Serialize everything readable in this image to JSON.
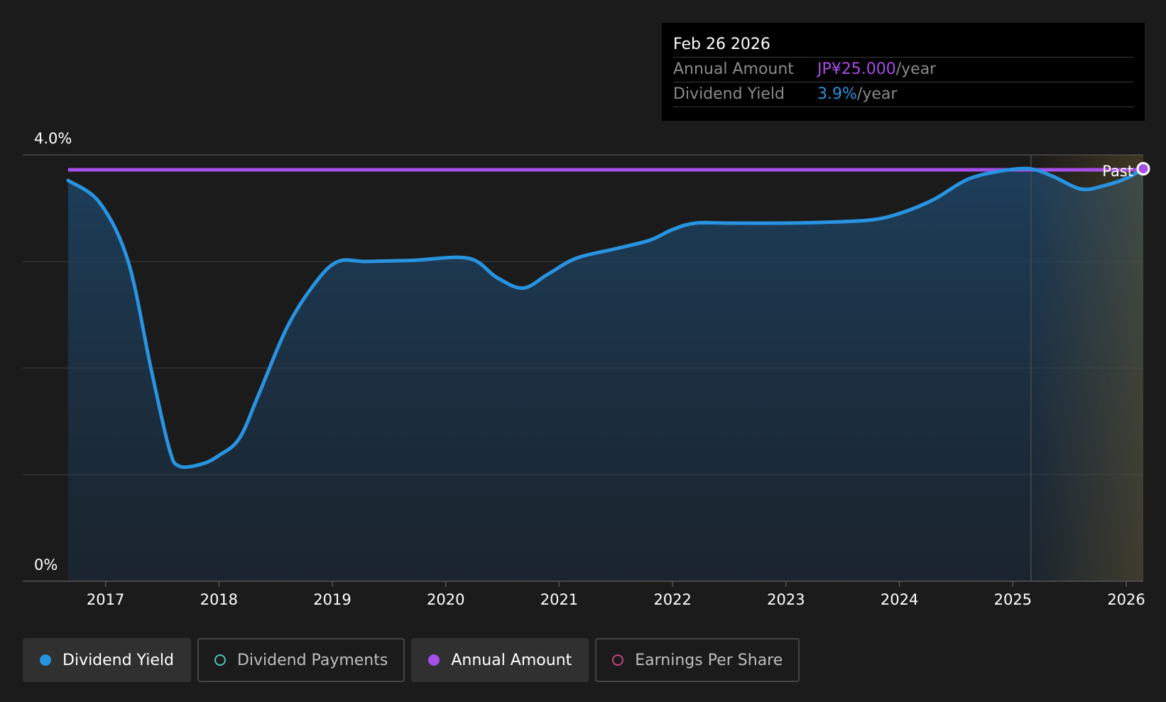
{
  "tooltip": {
    "date": "Feb 26 2026",
    "rows": [
      {
        "label": "Annual Amount",
        "value": "JP¥25.000",
        "unit": "/year",
        "color": "#a64ee8"
      },
      {
        "label": "Dividend Yield",
        "value": "3.9%",
        "unit": "/year",
        "color": "#2893e0"
      }
    ]
  },
  "past_label": "Past",
  "legend": [
    {
      "label": "Dividend Yield",
      "color": "#2893e0",
      "active": true
    },
    {
      "label": "Dividend Payments",
      "color": "#4fc4b0",
      "active": false
    },
    {
      "label": "Annual Amount",
      "color": "#a64ee8",
      "active": true
    },
    {
      "label": "Earnings Per Share",
      "color": "#c0457f",
      "active": false
    }
  ],
  "chart_data": {
    "type": "line",
    "x_range": [
      2016.27,
      2026.15
    ],
    "y_range": [
      0,
      4.0
    ],
    "y_tick_labels": [
      {
        "value": 4.0,
        "label": "4.0%"
      },
      {
        "value": 0,
        "label": "0%"
      }
    ],
    "gridlines": [
      1.0,
      2.0,
      3.0,
      4.0
    ],
    "x_ticks": [
      2017,
      2018,
      2019,
      2020,
      2021,
      2022,
      2023,
      2024,
      2025,
      2026
    ],
    "x_tick_labels": [
      "2017",
      "2018",
      "2019",
      "2020",
      "2021",
      "2022",
      "2023",
      "2024",
      "2025",
      "2026"
    ],
    "forecast_start": 2025.16,
    "series": [
      {
        "name": "Dividend Yield",
        "color": "#2893e0",
        "points": [
          [
            2016.67,
            3.76
          ],
          [
            2016.95,
            3.55
          ],
          [
            2017.2,
            3.0
          ],
          [
            2017.4,
            2.0
          ],
          [
            2017.56,
            1.25
          ],
          [
            2017.65,
            1.08
          ],
          [
            2017.85,
            1.1
          ],
          [
            2018.0,
            1.18
          ],
          [
            2018.18,
            1.34
          ],
          [
            2018.35,
            1.75
          ],
          [
            2018.6,
            2.38
          ],
          [
            2018.85,
            2.8
          ],
          [
            2019.05,
            3.0
          ],
          [
            2019.3,
            3.0
          ],
          [
            2019.7,
            3.01
          ],
          [
            2020.2,
            3.03
          ],
          [
            2020.45,
            2.85
          ],
          [
            2020.68,
            2.75
          ],
          [
            2020.9,
            2.88
          ],
          [
            2021.15,
            3.03
          ],
          [
            2021.5,
            3.12
          ],
          [
            2021.8,
            3.2
          ],
          [
            2022.0,
            3.3
          ],
          [
            2022.2,
            3.36
          ],
          [
            2022.5,
            3.36
          ],
          [
            2023.0,
            3.36
          ],
          [
            2023.4,
            3.37
          ],
          [
            2023.75,
            3.39
          ],
          [
            2024.0,
            3.45
          ],
          [
            2024.3,
            3.58
          ],
          [
            2024.6,
            3.77
          ],
          [
            2024.9,
            3.85
          ],
          [
            2025.15,
            3.87
          ],
          [
            2025.35,
            3.8
          ],
          [
            2025.6,
            3.68
          ],
          [
            2025.8,
            3.71
          ],
          [
            2026.0,
            3.78
          ],
          [
            2026.15,
            3.87
          ]
        ]
      },
      {
        "name": "Annual Amount",
        "color": "#a64ee8",
        "points": [
          [
            2016.67,
            3.86
          ],
          [
            2026.15,
            3.86
          ]
        ]
      }
    ]
  }
}
